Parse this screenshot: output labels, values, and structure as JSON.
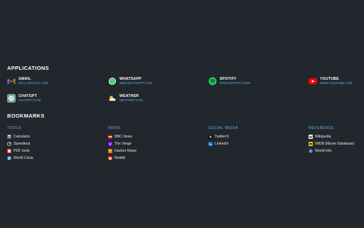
{
  "applications": {
    "title": "APPLICATIONS",
    "items": [
      {
        "name": "GMAIL",
        "url": "MAIL.GOOGLE.COM",
        "icon": "gmail-icon"
      },
      {
        "name": "WHATSAPP",
        "url": "WEB.WHATSAPP.COM",
        "icon": "whatsapp-icon"
      },
      {
        "name": "SPOTIFY",
        "url": "OPEN.SPOTIFY.COM",
        "icon": "spotify-icon"
      },
      {
        "name": "YOUTUBE",
        "url": "WWW.YOUTUBE.COM",
        "icon": "youtube-icon"
      },
      {
        "name": "CHATGPT",
        "url": "CHATGPT.COM",
        "icon": "chatgpt-icon"
      },
      {
        "name": "WEATHER",
        "url": "WEATHER.COM",
        "icon": "weather-icon"
      }
    ]
  },
  "bookmarks": {
    "title": "BOOKMARKS",
    "columns": [
      {
        "heading": "TOOLS",
        "items": [
          "Calculator",
          "Speedtest",
          "PDF tools",
          "World Clock"
        ]
      },
      {
        "heading": "NEWS",
        "items": [
          "BBC News",
          "The Verge",
          "Hacker News",
          "Reddit"
        ]
      },
      {
        "heading": "SOCIAL MEDIA",
        "items": [
          "Twitter/X",
          "LinkedIn"
        ]
      },
      {
        "heading": "REFERENCE",
        "items": [
          "Wikipedia",
          "IMDB (Movie Database)",
          "World Info"
        ]
      }
    ]
  },
  "colors": {
    "background": "#22272e",
    "accent": "#5fb3e8"
  }
}
